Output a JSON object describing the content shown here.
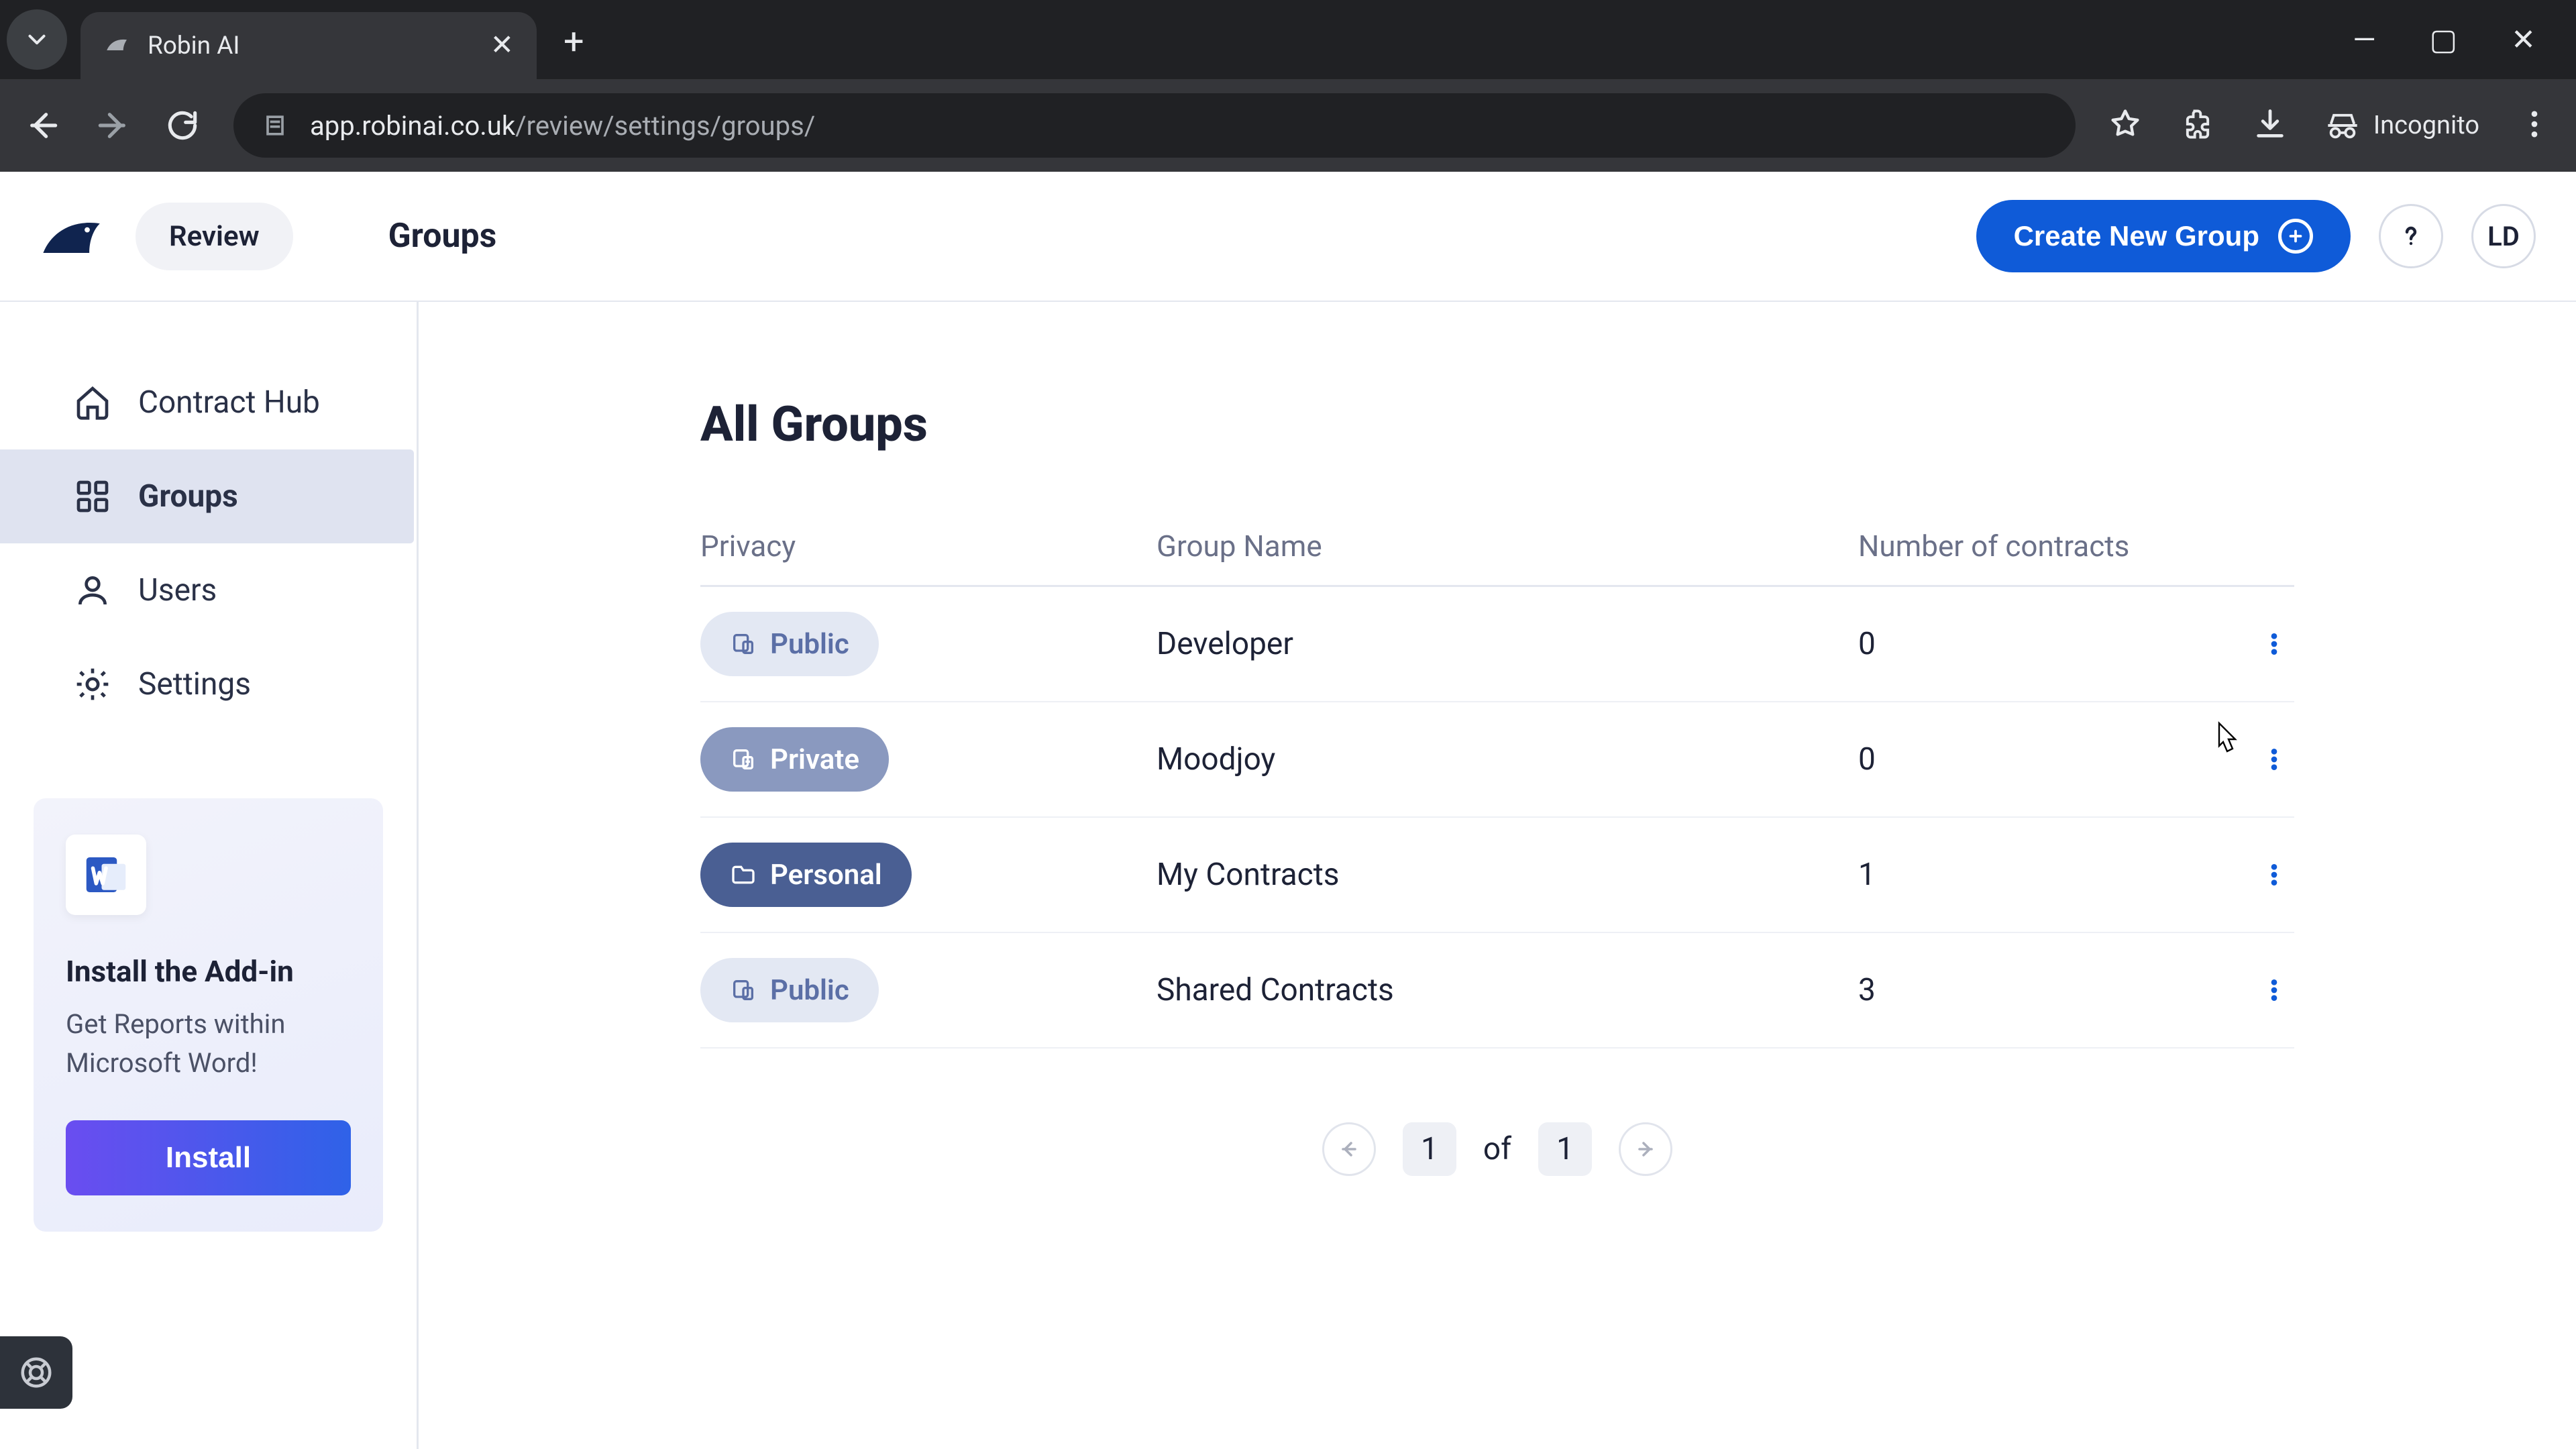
{
  "browser": {
    "tab_title": "Robin AI",
    "url_host": "app.robinai.co.uk",
    "url_path": "/review/settings/groups/",
    "incognito_label": "Incognito"
  },
  "header": {
    "review_chip": "Review",
    "page_title": "Groups",
    "create_button": "Create New Group",
    "avatar": "LD"
  },
  "sidebar": {
    "items": [
      {
        "label": "Contract Hub"
      },
      {
        "label": "Groups"
      },
      {
        "label": "Users"
      },
      {
        "label": "Settings"
      }
    ],
    "addin": {
      "title": "Install the Add-in",
      "body": "Get Reports within Microsoft Word!",
      "button": "Install"
    }
  },
  "main": {
    "heading": "All Groups",
    "columns": {
      "privacy": "Privacy",
      "name": "Group Name",
      "count": "Number of contracts"
    },
    "rows": [
      {
        "privacy": "Public",
        "name": "Developer",
        "count": "0"
      },
      {
        "privacy": "Private",
        "name": "Moodjoy",
        "count": "0"
      },
      {
        "privacy": "Personal",
        "name": "My Contracts",
        "count": "1"
      },
      {
        "privacy": "Public",
        "name": "Shared Contracts",
        "count": "3"
      }
    ],
    "pager": {
      "current": "1",
      "of_label": "of",
      "total": "1"
    }
  }
}
